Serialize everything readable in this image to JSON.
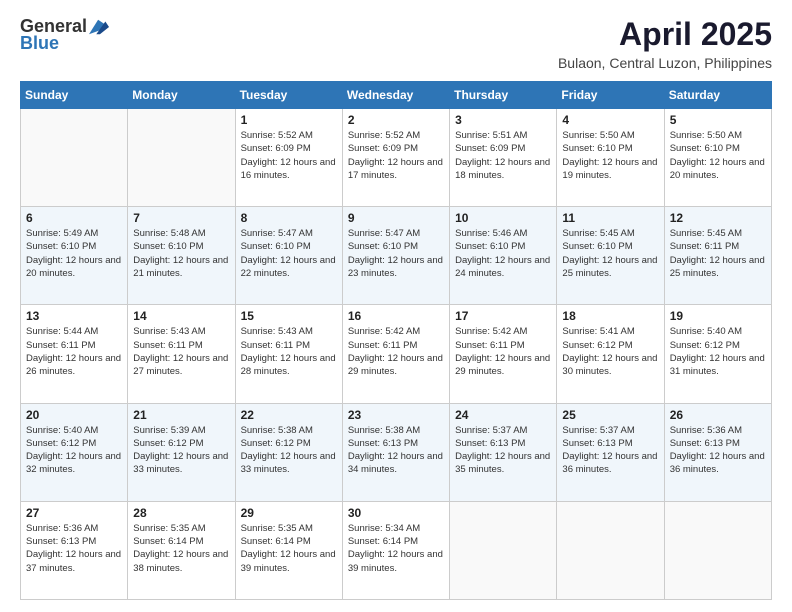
{
  "logo": {
    "general": "General",
    "blue": "Blue"
  },
  "title": "April 2025",
  "location": "Bulaon, Central Luzon, Philippines",
  "days_of_week": [
    "Sunday",
    "Monday",
    "Tuesday",
    "Wednesday",
    "Thursday",
    "Friday",
    "Saturday"
  ],
  "weeks": [
    [
      {
        "day": "",
        "info": ""
      },
      {
        "day": "",
        "info": ""
      },
      {
        "day": "1",
        "info": "Sunrise: 5:52 AM\nSunset: 6:09 PM\nDaylight: 12 hours and 16 minutes."
      },
      {
        "day": "2",
        "info": "Sunrise: 5:52 AM\nSunset: 6:09 PM\nDaylight: 12 hours and 17 minutes."
      },
      {
        "day": "3",
        "info": "Sunrise: 5:51 AM\nSunset: 6:09 PM\nDaylight: 12 hours and 18 minutes."
      },
      {
        "day": "4",
        "info": "Sunrise: 5:50 AM\nSunset: 6:10 PM\nDaylight: 12 hours and 19 minutes."
      },
      {
        "day": "5",
        "info": "Sunrise: 5:50 AM\nSunset: 6:10 PM\nDaylight: 12 hours and 20 minutes."
      }
    ],
    [
      {
        "day": "6",
        "info": "Sunrise: 5:49 AM\nSunset: 6:10 PM\nDaylight: 12 hours and 20 minutes."
      },
      {
        "day": "7",
        "info": "Sunrise: 5:48 AM\nSunset: 6:10 PM\nDaylight: 12 hours and 21 minutes."
      },
      {
        "day": "8",
        "info": "Sunrise: 5:47 AM\nSunset: 6:10 PM\nDaylight: 12 hours and 22 minutes."
      },
      {
        "day": "9",
        "info": "Sunrise: 5:47 AM\nSunset: 6:10 PM\nDaylight: 12 hours and 23 minutes."
      },
      {
        "day": "10",
        "info": "Sunrise: 5:46 AM\nSunset: 6:10 PM\nDaylight: 12 hours and 24 minutes."
      },
      {
        "day": "11",
        "info": "Sunrise: 5:45 AM\nSunset: 6:10 PM\nDaylight: 12 hours and 25 minutes."
      },
      {
        "day": "12",
        "info": "Sunrise: 5:45 AM\nSunset: 6:11 PM\nDaylight: 12 hours and 25 minutes."
      }
    ],
    [
      {
        "day": "13",
        "info": "Sunrise: 5:44 AM\nSunset: 6:11 PM\nDaylight: 12 hours and 26 minutes."
      },
      {
        "day": "14",
        "info": "Sunrise: 5:43 AM\nSunset: 6:11 PM\nDaylight: 12 hours and 27 minutes."
      },
      {
        "day": "15",
        "info": "Sunrise: 5:43 AM\nSunset: 6:11 PM\nDaylight: 12 hours and 28 minutes."
      },
      {
        "day": "16",
        "info": "Sunrise: 5:42 AM\nSunset: 6:11 PM\nDaylight: 12 hours and 29 minutes."
      },
      {
        "day": "17",
        "info": "Sunrise: 5:42 AM\nSunset: 6:11 PM\nDaylight: 12 hours and 29 minutes."
      },
      {
        "day": "18",
        "info": "Sunrise: 5:41 AM\nSunset: 6:12 PM\nDaylight: 12 hours and 30 minutes."
      },
      {
        "day": "19",
        "info": "Sunrise: 5:40 AM\nSunset: 6:12 PM\nDaylight: 12 hours and 31 minutes."
      }
    ],
    [
      {
        "day": "20",
        "info": "Sunrise: 5:40 AM\nSunset: 6:12 PM\nDaylight: 12 hours and 32 minutes."
      },
      {
        "day": "21",
        "info": "Sunrise: 5:39 AM\nSunset: 6:12 PM\nDaylight: 12 hours and 33 minutes."
      },
      {
        "day": "22",
        "info": "Sunrise: 5:38 AM\nSunset: 6:12 PM\nDaylight: 12 hours and 33 minutes."
      },
      {
        "day": "23",
        "info": "Sunrise: 5:38 AM\nSunset: 6:13 PM\nDaylight: 12 hours and 34 minutes."
      },
      {
        "day": "24",
        "info": "Sunrise: 5:37 AM\nSunset: 6:13 PM\nDaylight: 12 hours and 35 minutes."
      },
      {
        "day": "25",
        "info": "Sunrise: 5:37 AM\nSunset: 6:13 PM\nDaylight: 12 hours and 36 minutes."
      },
      {
        "day": "26",
        "info": "Sunrise: 5:36 AM\nSunset: 6:13 PM\nDaylight: 12 hours and 36 minutes."
      }
    ],
    [
      {
        "day": "27",
        "info": "Sunrise: 5:36 AM\nSunset: 6:13 PM\nDaylight: 12 hours and 37 minutes."
      },
      {
        "day": "28",
        "info": "Sunrise: 5:35 AM\nSunset: 6:14 PM\nDaylight: 12 hours and 38 minutes."
      },
      {
        "day": "29",
        "info": "Sunrise: 5:35 AM\nSunset: 6:14 PM\nDaylight: 12 hours and 39 minutes."
      },
      {
        "day": "30",
        "info": "Sunrise: 5:34 AM\nSunset: 6:14 PM\nDaylight: 12 hours and 39 minutes."
      },
      {
        "day": "",
        "info": ""
      },
      {
        "day": "",
        "info": ""
      },
      {
        "day": "",
        "info": ""
      }
    ]
  ]
}
